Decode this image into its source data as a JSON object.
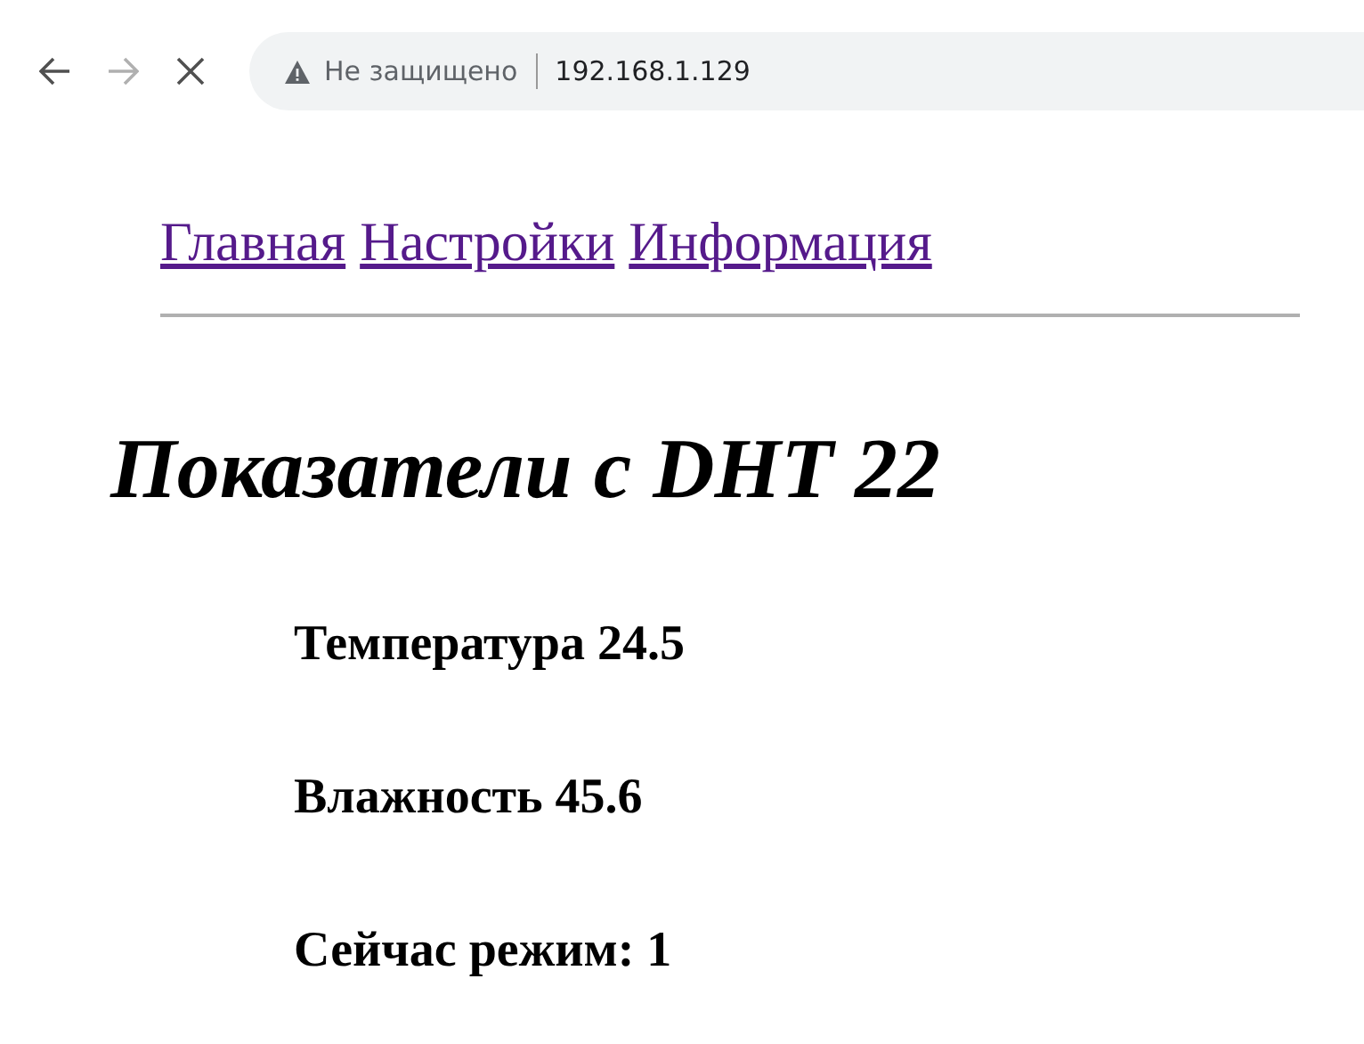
{
  "browser": {
    "back": {
      "disabled": false
    },
    "forward": {
      "disabled": true
    },
    "security_label": "Не защищено",
    "url": "192.168.1.129"
  },
  "nav_links": [
    {
      "label": "Главная"
    },
    {
      "label": "Настройки"
    },
    {
      "label": "Информация"
    }
  ],
  "heading": "Показатели с DHT 22",
  "readings": [
    "Температура 24.5",
    "Влажность 45.6",
    "Сейчас режим: 1"
  ]
}
